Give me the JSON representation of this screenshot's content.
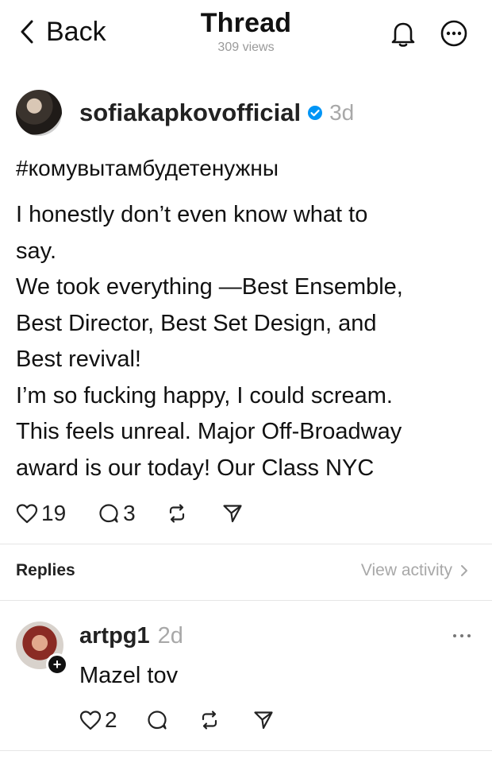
{
  "header": {
    "back_label": "Back",
    "title": "Thread",
    "views": "309 views"
  },
  "post": {
    "username": "sofiakapkovofficial",
    "verified": true,
    "time": "3d",
    "hashtag": "#комувытамбудетенужны",
    "body_lines": [
      "I honestly don’t even know what to",
      "say.",
      "We took everything —Best Ensemble,",
      "Best Director, Best Set Design, and",
      "Best  revival!",
      "I’m so fucking happy,  I could scream.",
      "This feels unreal. Major Off-Broadway",
      "award is our today! Our Class NYC"
    ],
    "likes": "19",
    "replies": "3"
  },
  "replies_section": {
    "label": "Replies",
    "view_activity": "View activity"
  },
  "reply": {
    "username": "artpg1",
    "time": "2d",
    "text": "Mazel tov",
    "likes": "2"
  },
  "icons": {
    "back": "chevron-left-icon",
    "bell": "bell-icon",
    "more": "more-circle-icon",
    "verified": "verified-badge-icon",
    "like": "heart-icon",
    "comment": "comment-icon",
    "repost": "repost-icon",
    "share": "send-icon",
    "plus": "plus-icon",
    "reply_more": "more-horizontal-icon",
    "activity_chevron": "chevron-right-icon"
  },
  "colors": {
    "verified_blue": "#0095f6",
    "secondary_text": "#a8a8a8",
    "divider": "#e6e6e6"
  }
}
